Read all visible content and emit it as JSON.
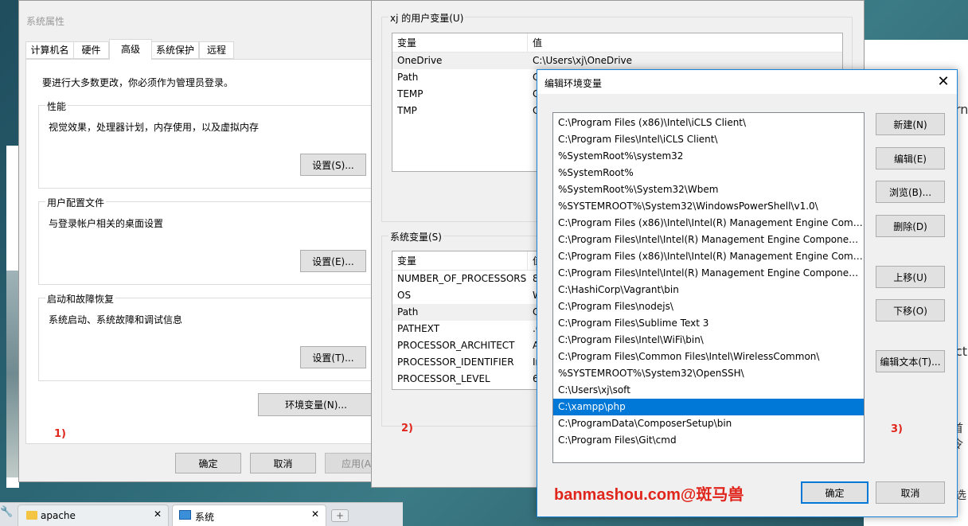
{
  "sysprops": {
    "title": "系统属性",
    "tabs": [
      "计算机名",
      "硬件",
      "高级",
      "系统保护",
      "远程"
    ],
    "admin_note": "要进行大多数更改，你必须作为管理员登录。",
    "perf_title": "性能",
    "perf_desc": "视觉效果，处理器计划，内存使用，以及虚拟内存",
    "perf_btn": "设置(S)...",
    "profile_title": "用户配置文件",
    "profile_desc": "与登录帐户相关的桌面设置",
    "profile_btn": "设置(E)...",
    "startup_title": "启动和故障恢复",
    "startup_desc": "系统启动、系统故障和调试信息",
    "startup_btn": "设置(T)...",
    "env_btn": "环境变量(N)...",
    "ok": "确定",
    "cancel": "取消",
    "apply": "应用(A",
    "marker": "1)"
  },
  "envvars": {
    "user_title": "xj 的用户变量(U)",
    "col_var": "变量",
    "col_val": "值",
    "user_rows": [
      {
        "name": "OneDrive",
        "value": "C:\\Users\\xj\\OneDrive"
      },
      {
        "name": "Path",
        "value": "C"
      },
      {
        "name": "TEMP",
        "value": "C"
      },
      {
        "name": "TMP",
        "value": "C"
      }
    ],
    "sys_title": "系统变量(S)",
    "sys_rows": [
      {
        "name": "NUMBER_OF_PROCESSORS",
        "value": "8"
      },
      {
        "name": "OS",
        "value": "W"
      },
      {
        "name": "Path",
        "value": "C"
      },
      {
        "name": "PATHEXT",
        "value": ".C"
      },
      {
        "name": "PROCESSOR_ARCHITECT",
        "value": "A"
      },
      {
        "name": "PROCESSOR_IDENTIFIER",
        "value": "In"
      },
      {
        "name": "PROCESSOR_LEVEL",
        "value": "6"
      }
    ],
    "marker": "2)"
  },
  "editenv": {
    "title": "编辑环境变量",
    "paths": [
      "C:\\Program Files (x86)\\Intel\\iCLS Client\\",
      "C:\\Program Files\\Intel\\iCLS Client\\",
      "%SystemRoot%\\system32",
      "%SystemRoot%",
      "%SystemRoot%\\System32\\Wbem",
      "%SYSTEMROOT%\\System32\\WindowsPowerShell\\v1.0\\",
      "C:\\Program Files (x86)\\Intel\\Intel(R) Management Engine Comp...",
      "C:\\Program Files\\Intel\\Intel(R) Management Engine Component...",
      "C:\\Program Files (x86)\\Intel\\Intel(R) Management Engine Comp...",
      "C:\\Program Files\\Intel\\Intel(R) Management Engine Component...",
      "C:\\HashiCorp\\Vagrant\\bin",
      "C:\\Program Files\\nodejs\\",
      "C:\\Program Files\\Sublime Text 3",
      "C:\\Program Files\\Intel\\WiFi\\bin\\",
      "C:\\Program Files\\Common Files\\Intel\\WirelessCommon\\",
      "%SYSTEMROOT%\\System32\\OpenSSH\\",
      "C:\\Users\\xj\\soft",
      "C:\\xampp\\php",
      "C:\\ProgramData\\ComposerSetup\\bin",
      "C:\\Program Files\\Git\\cmd"
    ],
    "selected_index": 17,
    "btn_new": "新建(N)",
    "btn_edit": "编辑(E)",
    "btn_browse": "浏览(B)...",
    "btn_delete": "删除(D)",
    "btn_up": "上移(U)",
    "btn_down": "下移(O)",
    "btn_edittext": "编辑文本(T)...",
    "ok": "确定",
    "cancel": "取消",
    "marker": "3)",
    "watermark": "banmashou.com@斑马兽"
  },
  "taskbar": {
    "tab1": "apache",
    "tab2": "系统"
  },
  "background_text": {
    "frag1": "rn",
    "frag2": "ct",
    "frag3": "首令",
    "frag4": "选"
  }
}
